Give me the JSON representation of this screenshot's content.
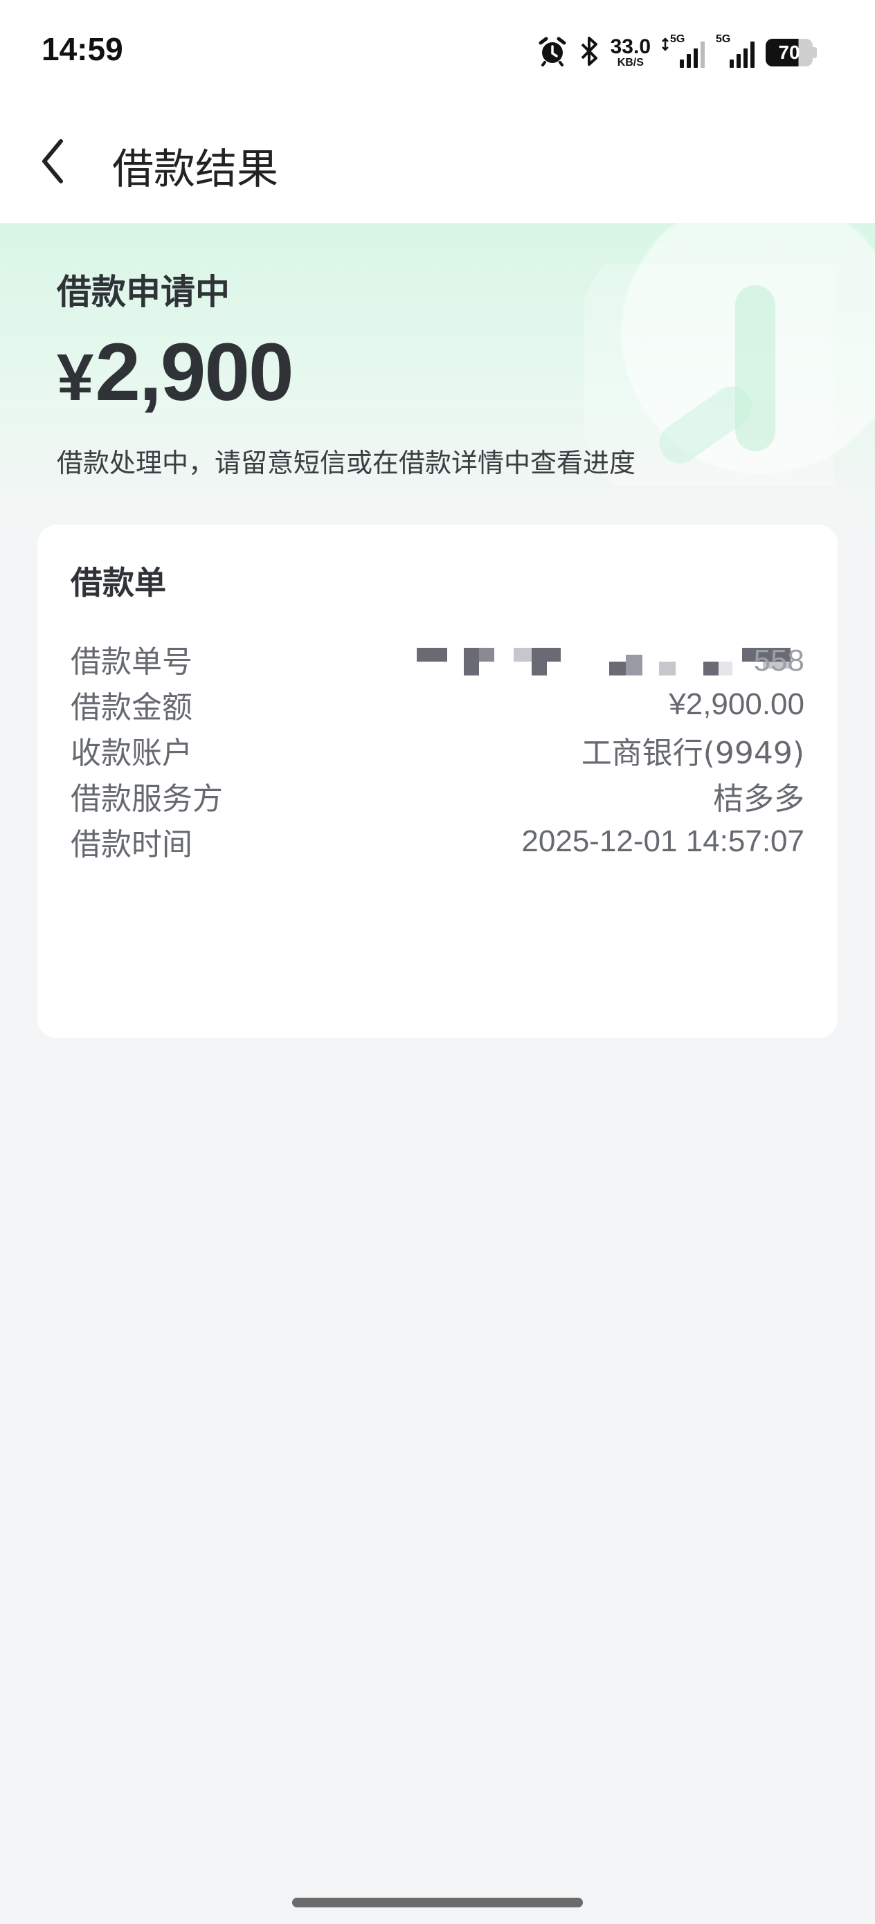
{
  "status_bar": {
    "time": "14:59",
    "net_speed_value": "33.0",
    "net_speed_unit": "KB/S",
    "signal_1_tag": "5G",
    "signal_2_tag": "5G",
    "battery": "70",
    "icons": [
      "alarm-icon",
      "bluetooth-icon",
      "signal-icon",
      "battery-icon"
    ]
  },
  "nav": {
    "back_icon": "chevron-left-icon",
    "title": "借款结果"
  },
  "hero": {
    "status": "借款申请中",
    "amount_symbol": "¥",
    "amount": "2,900",
    "note": "借款处理中，请留意短信或在借款详情中查看进度"
  },
  "card": {
    "title": "借款单",
    "rows": [
      {
        "label": "借款单号",
        "value": "558"
      },
      {
        "label": "借款金额",
        "value": "¥2,900.00"
      },
      {
        "label": "收款账户",
        "value": "工商银行(9949)"
      },
      {
        "label": "借款服务方",
        "value": "桔多多"
      },
      {
        "label": "借款时间",
        "value": "2025-12-01 14:57:07"
      }
    ]
  },
  "colors": {
    "hero_gradient_top": "#d9f6e6",
    "page_background": "#f4f5f7",
    "card_background": "#ffffff",
    "primary_text": "#2f3338",
    "secondary_text": "#666a70"
  }
}
